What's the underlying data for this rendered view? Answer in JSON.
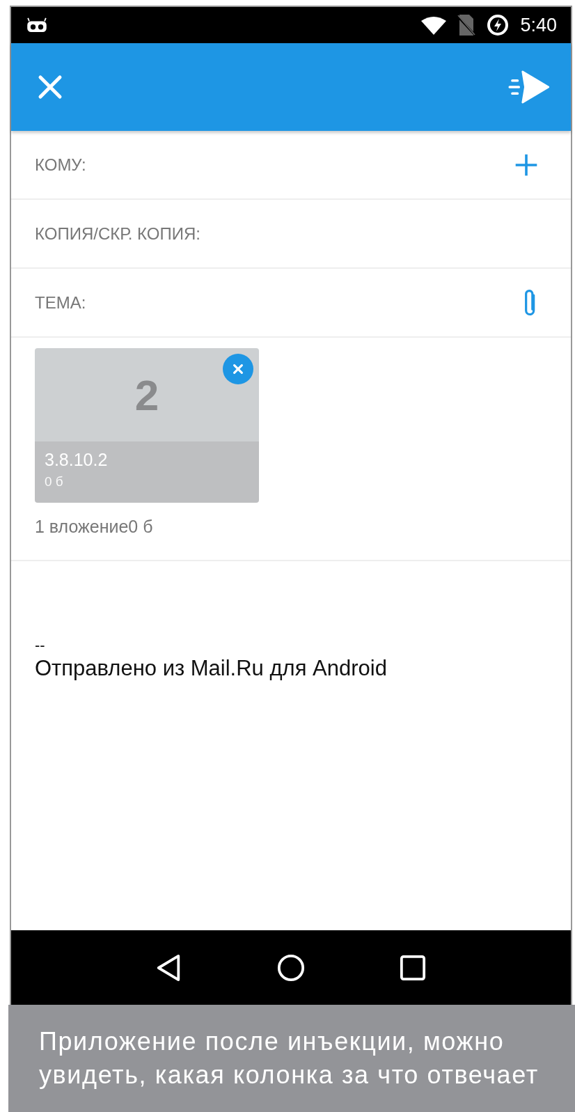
{
  "status_bar": {
    "time": "5:40"
  },
  "fields": [
    {
      "label": "КОМУ:",
      "kind": "add"
    },
    {
      "label": "КОПИЯ/СКР. КОПИЯ:",
      "kind": "plain"
    },
    {
      "label": "ТЕМА:",
      "kind": "attach"
    }
  ],
  "attachments": [
    {
      "thumbnail": "2",
      "name": "3.8.10.2",
      "size": "0 б"
    }
  ],
  "attachments_summary": "1 вложение0  б",
  "body": {
    "separator": "--",
    "signature": "Отправлено из Mail.Ru для Android"
  },
  "caption": "Приложение после инъекции, можно увидеть, какая колонка за что отвечает"
}
